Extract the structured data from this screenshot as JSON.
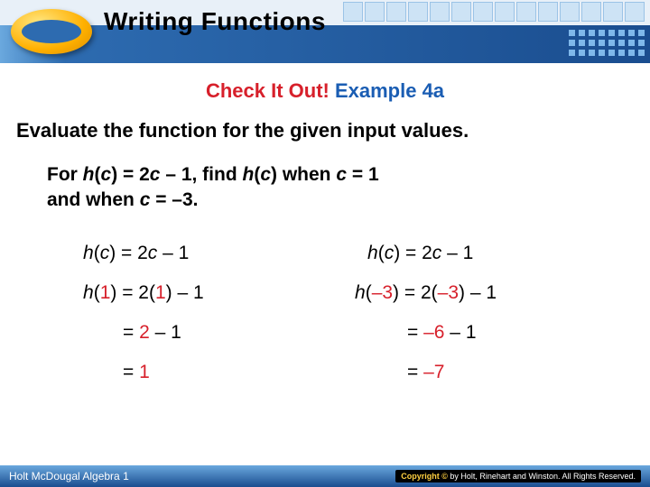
{
  "header": {
    "title": "Writing Functions"
  },
  "subtitle": {
    "part1": "Check It Out! ",
    "part2": "Example 4a"
  },
  "instruction": "Evaluate the function for the given input values.",
  "problem": {
    "line1_a": "For ",
    "line1_b": "h",
    "line1_c": "(",
    "line1_d": "c",
    "line1_e": ") = 2",
    "line1_f": "c",
    "line1_g": " – 1, find ",
    "line1_h": "h",
    "line1_i": "(",
    "line1_j": "c",
    "line1_k": ") when ",
    "line1_l": "c",
    "line1_m": " = 1",
    "line2_a": "and when ",
    "line2_b": "c",
    "line2_c": " = –3."
  },
  "col1": {
    "r1_a": "h",
    "r1_b": "(",
    "r1_c": "c",
    "r1_d": ") = 2",
    "r1_e": "c",
    "r1_f": " – 1",
    "r2_a": "h",
    "r2_b": "(",
    "r2_c": "1",
    "r2_d": ") = 2(",
    "r2_e": "1",
    "r2_f": ") – 1",
    "r3_a": "= ",
    "r3_b": "2",
    "r3_c": " – 1",
    "r4_a": "= ",
    "r4_b": "1"
  },
  "col2": {
    "r1_a": "h",
    "r1_b": "(",
    "r1_c": "c",
    "r1_d": ") = 2",
    "r1_e": "c",
    "r1_f": " – 1",
    "r2_a": "h",
    "r2_b": "(",
    "r2_c": "–3",
    "r2_d": ") = 2(",
    "r2_e": "–3",
    "r2_f": ") – 1",
    "r3_a": "= ",
    "r3_b": "–6",
    "r3_c": " – 1",
    "r4_a": "= ",
    "r4_b": "–7"
  },
  "footer": {
    "left": "Holt McDougal Algebra 1",
    "right_prefix": "Copyright ©",
    "right_text": " by Holt, Rinehart and Winston. All Rights Reserved."
  }
}
